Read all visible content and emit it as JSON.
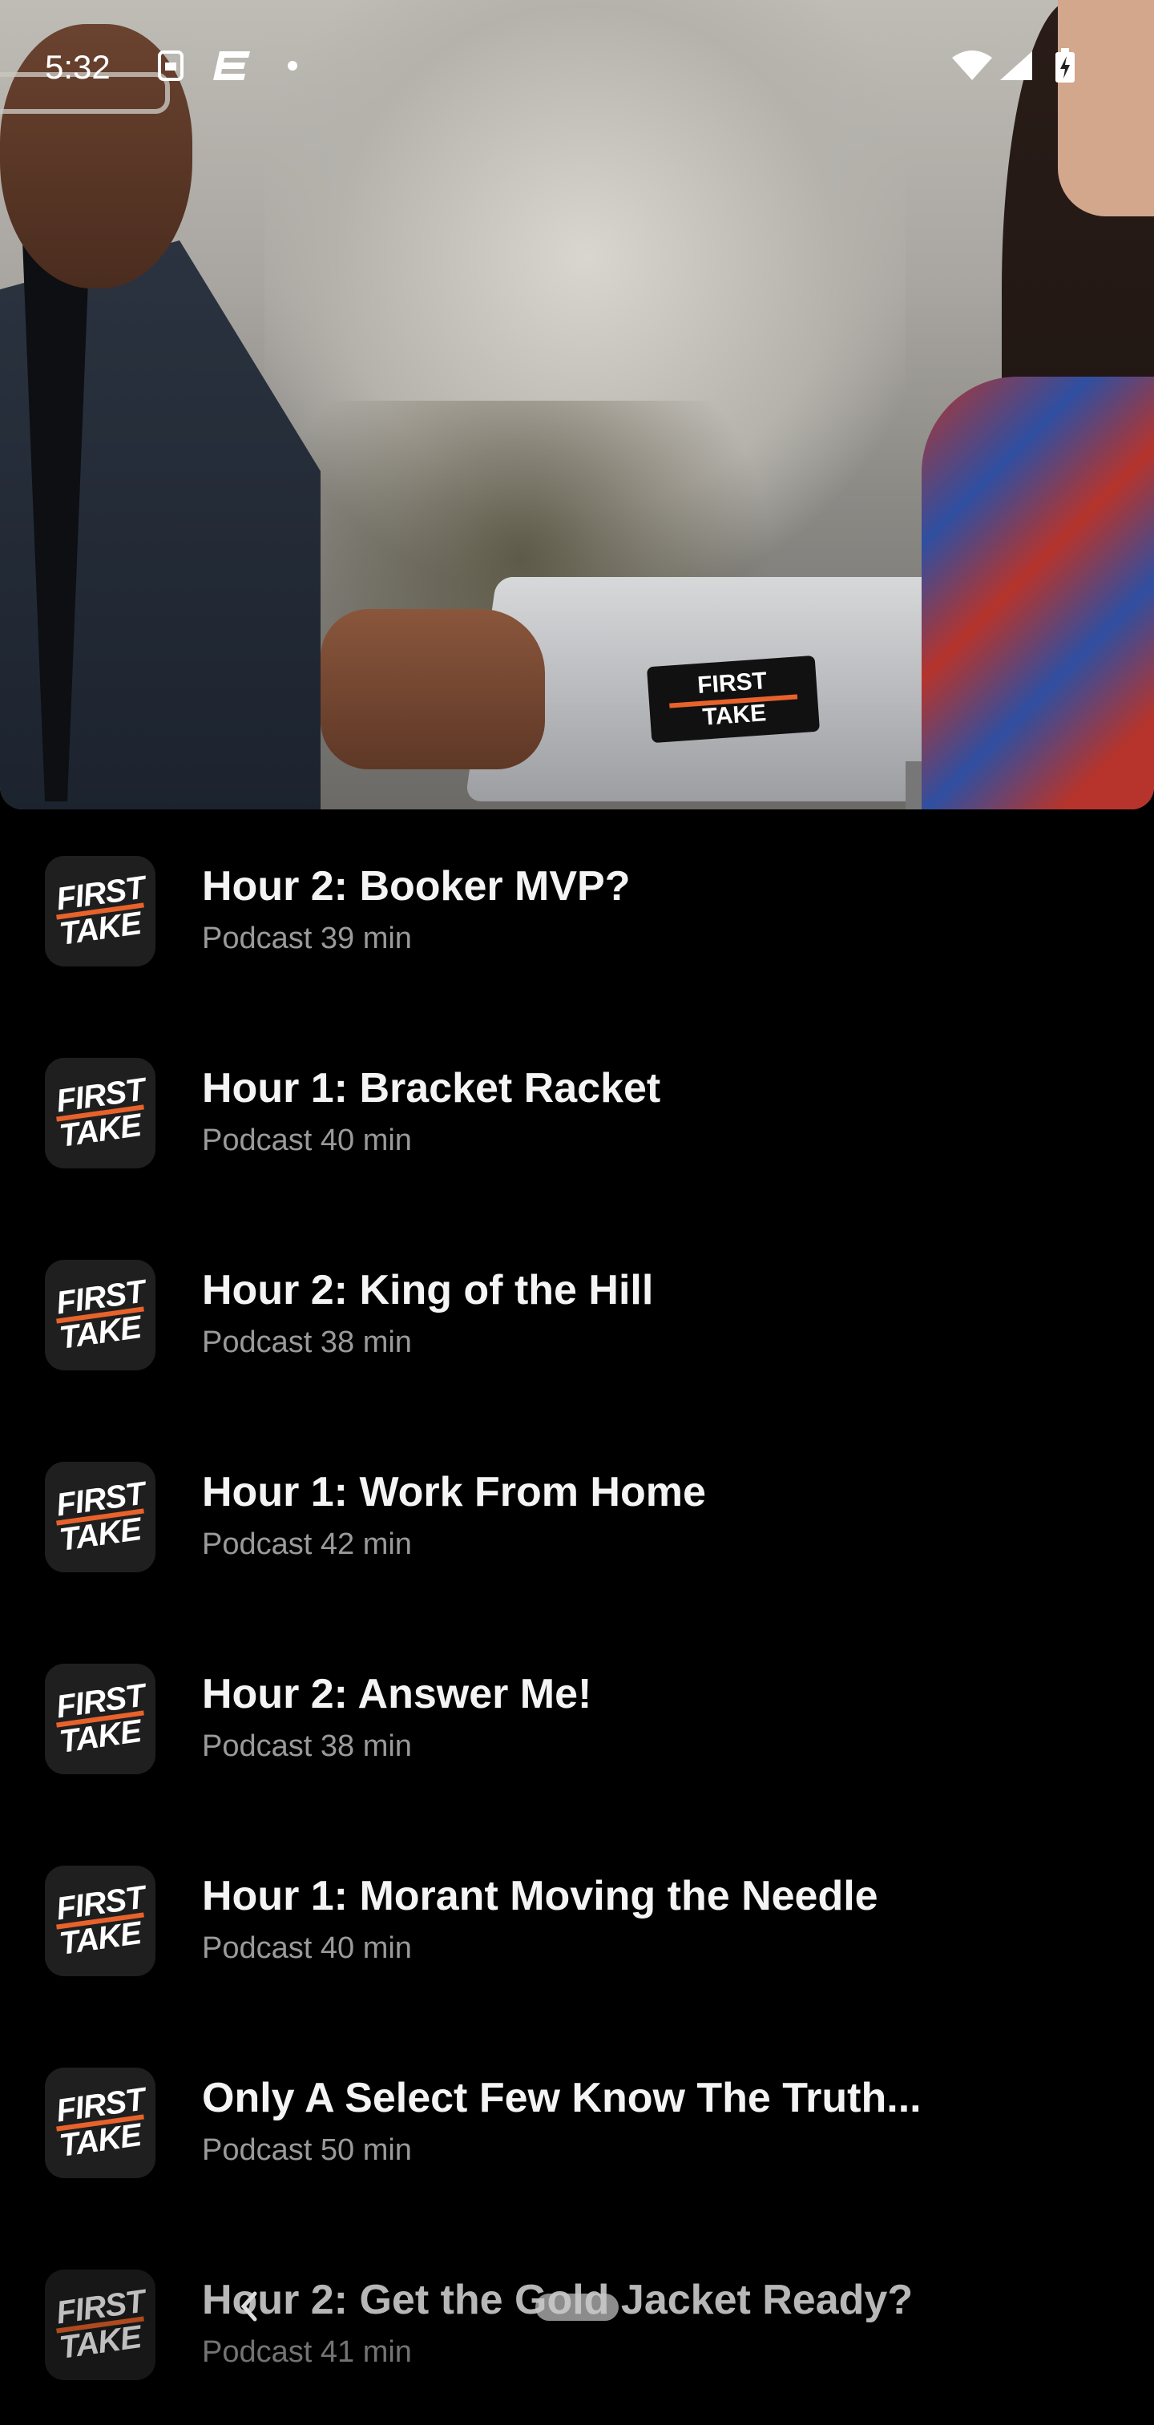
{
  "status_bar": {
    "time": "5:32",
    "icons": [
      "sim-icon",
      "espn-icon",
      "dot-icon",
      "wifi-icon",
      "signal-icon",
      "battery-charging-icon"
    ]
  },
  "hero": {
    "laptop_logo_line1": "FIRST",
    "laptop_logo_line2": "TAKE"
  },
  "episodes": [
    {
      "title": "Hour 2: Booker MVP?",
      "meta": "Podcast 39 min"
    },
    {
      "title": "Hour 1: Bracket Racket",
      "meta": "Podcast 40 min"
    },
    {
      "title": "Hour 2: King of the Hill",
      "meta": "Podcast 38 min"
    },
    {
      "title": "Hour 1: Work From Home",
      "meta": "Podcast 42 min"
    },
    {
      "title": "Hour 2: Answer Me!",
      "meta": "Podcast 38 min"
    },
    {
      "title": "Hour 1: Morant Moving the Needle",
      "meta": "Podcast 40 min"
    },
    {
      "title": "Only A Select Few Know The Truth...",
      "meta": "Podcast 50 min"
    },
    {
      "title": "Hour 2: Get the Gold Jacket Ready?",
      "meta": "Podcast 41 min"
    }
  ],
  "thumb_logo": {
    "line1": "FIRST",
    "line2": "TAKE"
  },
  "colors": {
    "accent": "#e8622b",
    "background": "#000000",
    "meta_text": "#9a9a9a"
  }
}
